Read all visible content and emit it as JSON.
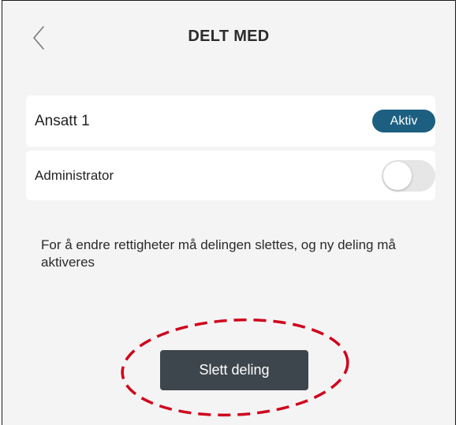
{
  "header": {
    "title": "DELT MED",
    "back_icon": "chevron-left-icon"
  },
  "user": {
    "name": "Ansatt 1",
    "status": "Aktiv",
    "status_color": "#1c5f80"
  },
  "admin": {
    "label": "Administrator",
    "toggle_on": false
  },
  "info": {
    "text": "For å endre rettigheter må delingen slettes, og ny deling må aktiveres"
  },
  "actions": {
    "delete_label": "Slett deling",
    "highlight_color": "#d0021b"
  }
}
